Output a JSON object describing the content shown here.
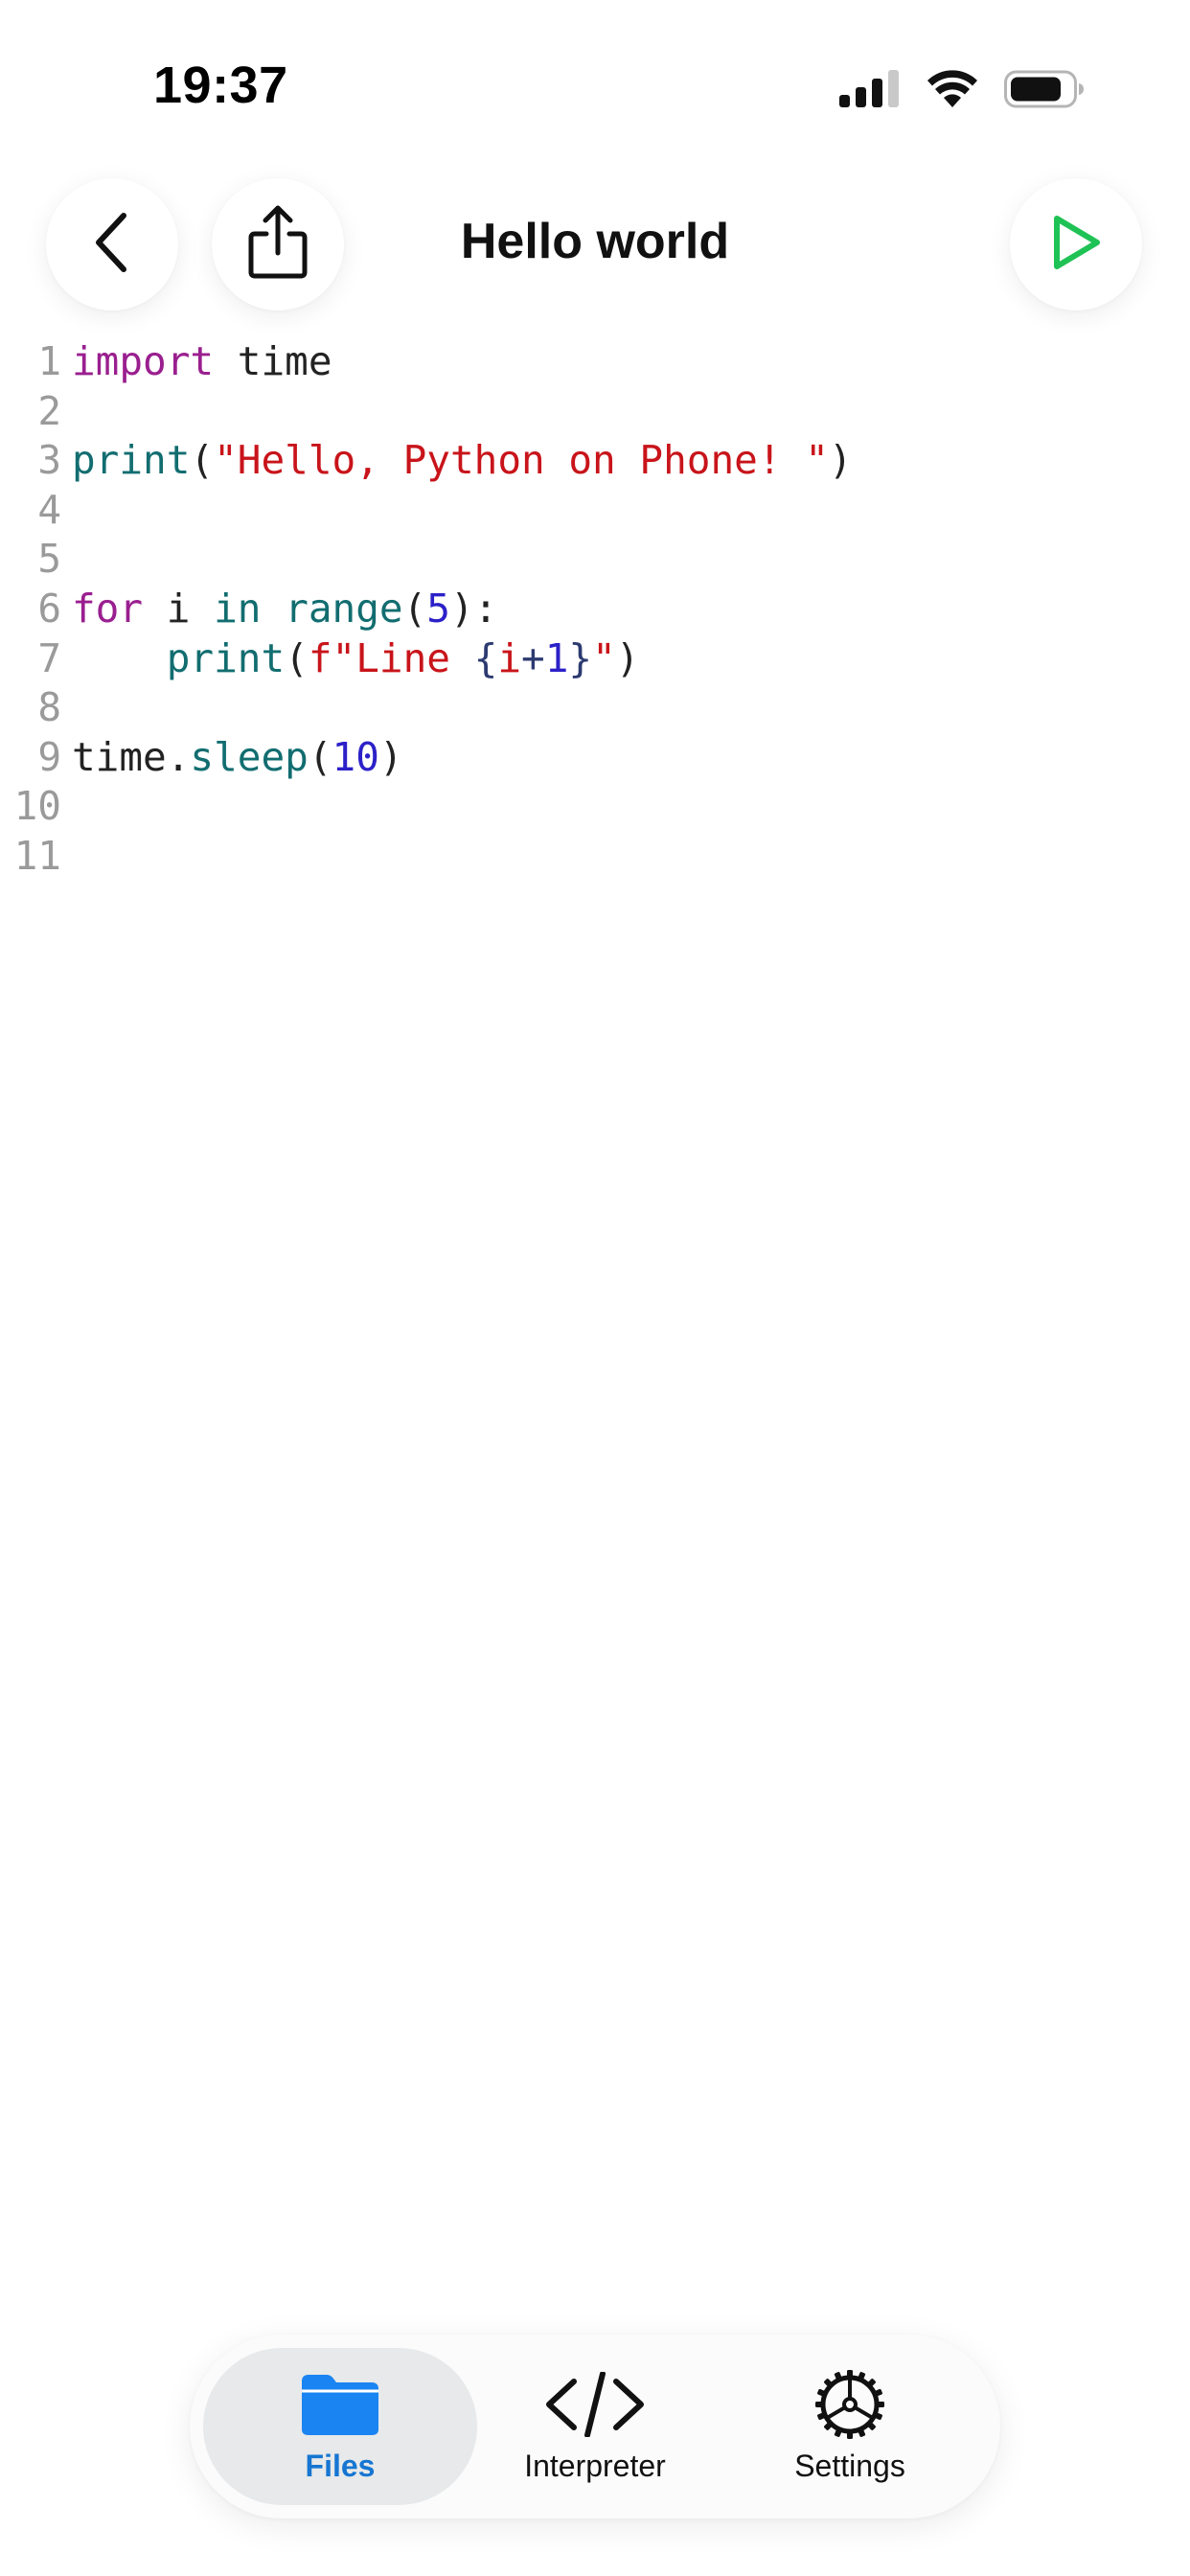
{
  "status_bar": {
    "time": "19:37",
    "icons": [
      "cellular-signal-icon",
      "wifi-icon",
      "battery-icon"
    ]
  },
  "nav": {
    "title": "Hello world",
    "back_icon": "chevron-left-icon",
    "share_icon": "share-icon",
    "run_icon": "play-icon",
    "run_color": "#1fc255"
  },
  "editor": {
    "lines": [
      {
        "number": "1",
        "tokens": [
          {
            "t": "import",
            "k": "keyword"
          },
          {
            "t": " time",
            "k": "plain"
          }
        ]
      },
      {
        "number": "2",
        "tokens": []
      },
      {
        "number": "3",
        "tokens": [
          {
            "t": "print",
            "k": "builtin"
          },
          {
            "t": "(",
            "k": "op"
          },
          {
            "t": "\"Hello, Python on Phone! \"",
            "k": "string"
          },
          {
            "t": ")",
            "k": "op"
          }
        ]
      },
      {
        "number": "4",
        "tokens": []
      },
      {
        "number": "5",
        "tokens": []
      },
      {
        "number": "6",
        "tokens": [
          {
            "t": "for",
            "k": "keyword"
          },
          {
            "t": " i ",
            "k": "plain"
          },
          {
            "t": "in",
            "k": "builtin"
          },
          {
            "t": " ",
            "k": "plain"
          },
          {
            "t": "range",
            "k": "builtin"
          },
          {
            "t": "(",
            "k": "op"
          },
          {
            "t": "5",
            "k": "number"
          },
          {
            "t": "):",
            "k": "op"
          }
        ]
      },
      {
        "number": "7",
        "tokens": [
          {
            "t": "    ",
            "k": "plain"
          },
          {
            "t": "print",
            "k": "builtin"
          },
          {
            "t": "(",
            "k": "op"
          },
          {
            "t": "f\"Line ",
            "k": "string"
          },
          {
            "t": "{",
            "k": "interp"
          },
          {
            "t": "i",
            "k": "string"
          },
          {
            "t": "+",
            "k": "interp"
          },
          {
            "t": "1",
            "k": "number"
          },
          {
            "t": "}",
            "k": "interp"
          },
          {
            "t": "\"",
            "k": "string"
          },
          {
            "t": ")",
            "k": "op"
          }
        ]
      },
      {
        "number": "8",
        "tokens": []
      },
      {
        "number": "9",
        "tokens": [
          {
            "t": "time.",
            "k": "plain"
          },
          {
            "t": "sleep",
            "k": "func"
          },
          {
            "t": "(",
            "k": "op"
          },
          {
            "t": "10",
            "k": "number"
          },
          {
            "t": ")",
            "k": "op"
          }
        ]
      },
      {
        "number": "10",
        "tokens": []
      },
      {
        "number": "11",
        "tokens": []
      }
    ]
  },
  "tab_bar": {
    "active": "files",
    "accent_color": "#1676d2",
    "tabs": [
      {
        "id": "files",
        "label": "Files",
        "icon": "folder-icon"
      },
      {
        "id": "interpreter",
        "label": "Interpreter",
        "icon": "code-brackets-icon"
      },
      {
        "id": "settings",
        "label": "Settings",
        "icon": "gear-icon"
      }
    ]
  }
}
